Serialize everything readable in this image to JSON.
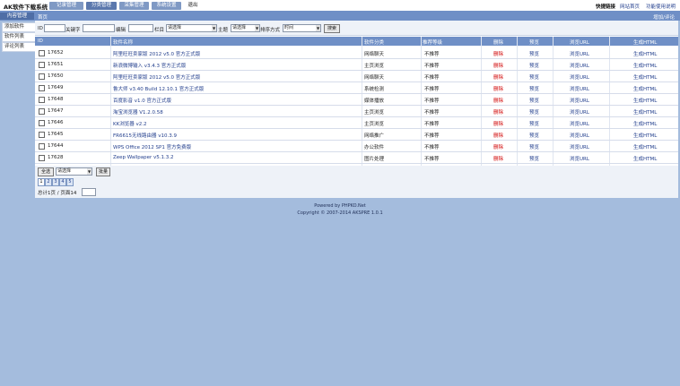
{
  "app": {
    "title": "AK软件下载系统"
  },
  "nav": {
    "tabs": [
      "记录管理",
      "分类管理",
      "采集管理",
      "系统设置",
      "退出"
    ]
  },
  "top_right": {
    "shortcut": "快捷链接",
    "home": "网站首页",
    "manual": "功能使用说明书"
  },
  "sidebar": {
    "header": "内容管理",
    "items": [
      "添加软件",
      "软件列表",
      "评论列表"
    ]
  },
  "breadcrumb": "首页",
  "breadcrumb_right": "增加/评论",
  "filter": {
    "id_label": "ID",
    "keyword_label": "关键字",
    "editor_label": "编辑",
    "column_label": "栏目",
    "column_value": "请选择",
    "topic_label": "主题",
    "topic_value": "请选择",
    "sort_label": "排序方式",
    "sort_value": "时间",
    "search_button": "搜索"
  },
  "table": {
    "headers": [
      "ID",
      "软件名称",
      "软件分类",
      "推荐等级",
      "删除",
      "预览",
      "浏览URL",
      "生成HTML"
    ],
    "rows": [
      {
        "id": "17652",
        "title": "阿里旺旺卖家版 2012 v5.0 官方正式版",
        "category": "网络聊天",
        "rec": "不推荐",
        "del": "删除",
        "preview": "预览",
        "url": "浏览URL",
        "gen": "生成HTML"
      },
      {
        "id": "17651",
        "title": "新浪微博输入 v3.4.3 官方正式版",
        "category": "主页浏览",
        "rec": "不推荐",
        "del": "删除",
        "preview": "预览",
        "url": "浏览URL",
        "gen": "生成HTML"
      },
      {
        "id": "17650",
        "title": "阿里旺旺卖家版 2012 v5.0 官方正式版",
        "category": "网络聊天",
        "rec": "不推荐",
        "del": "删除",
        "preview": "预览",
        "url": "浏览URL",
        "gen": "生成HTML"
      },
      {
        "id": "17649",
        "title": "鲁大师 v3.40 Build 12.10.1 官方正式版",
        "category": "系统检测",
        "rec": "不推荐",
        "del": "删除",
        "preview": "预览",
        "url": "浏览URL",
        "gen": "生成HTML"
      },
      {
        "id": "17648",
        "title": "百度影音 v1.0 官方正式版",
        "category": "媒体播放",
        "rec": "不推荐",
        "del": "删除",
        "preview": "预览",
        "url": "浏览URL",
        "gen": "生成HTML"
      },
      {
        "id": "17647",
        "title": "淘宝浏览器 V1.2.0.58",
        "category": "主页浏览",
        "rec": "不推荐",
        "del": "删除",
        "preview": "预览",
        "url": "浏览URL",
        "gen": "生成HTML"
      },
      {
        "id": "17646",
        "title": "KK浏览器 v2.2",
        "category": "主页浏览",
        "rec": "不推荐",
        "del": "删除",
        "preview": "预览",
        "url": "浏览URL",
        "gen": "生成HTML"
      },
      {
        "id": "17645",
        "title": "FR6615无线路由器 v10.3.9",
        "category": "网络推广",
        "rec": "不推荐",
        "del": "删除",
        "preview": "预览",
        "url": "浏览URL",
        "gen": "生成HTML"
      },
      {
        "id": "17644",
        "title": "WPS Office 2012 SP1 官方免费版",
        "category": "办公软件",
        "rec": "不推荐",
        "del": "删除",
        "preview": "预览",
        "url": "浏览URL",
        "gen": "生成HTML"
      },
      {
        "id": "17628",
        "title": "Zeep Wallpaper v5.1.3.2",
        "category": "图片处理",
        "rec": "不推荐",
        "del": "删除",
        "preview": "预览",
        "url": "浏览URL",
        "gen": "生成HTML"
      }
    ]
  },
  "footer": {
    "select_all": "全选",
    "batch_select": "请选择",
    "batch_button": "批量",
    "pages": [
      "1",
      "2",
      "3",
      "4",
      "5"
    ],
    "summary": "总计1页 / 页面14"
  },
  "copyright": {
    "line1": "Powered by PHPKO.Net",
    "line2": "Copyright © 2007-2014 AKSPRE 1.0.1"
  }
}
